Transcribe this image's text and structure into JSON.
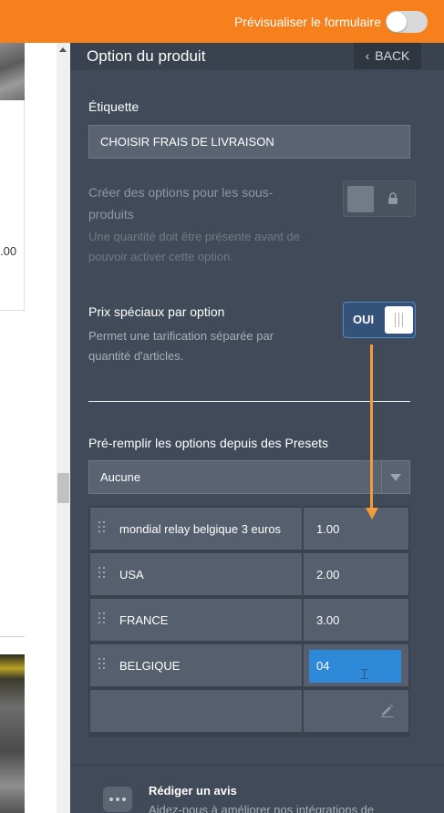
{
  "topbar": {
    "preview_label": "Prévisualiser le formulaire",
    "preview_enabled": false
  },
  "background": {
    "price_fragment": ".00"
  },
  "panel": {
    "title": "Option du produit",
    "back_label": "BACK",
    "label_field": {
      "title": "Étiquette",
      "value": "CHOISIR FRAIS DE LIVRAISON"
    },
    "sub_options": {
      "title": "Créer des options pour les sous-produits",
      "description": "Une quantité doit être présente avant de pouvoir activer cette option.",
      "locked": true
    },
    "special_prices": {
      "title": "Prix spéciaux par option",
      "description": "Permet une tarification séparée par quantité d'articles.",
      "toggle_label": "OUI",
      "enabled": true
    },
    "presets": {
      "title": "Pré-remplir les options depuis des Presets",
      "selected": "Aucune"
    },
    "options": [
      {
        "name": "mondial relay belgique 3 euros",
        "price": "1.00"
      },
      {
        "name": "USA",
        "price": "2.00"
      },
      {
        "name": "FRANCE",
        "price": "3.00"
      },
      {
        "name": "BELGIQUE",
        "price": "04"
      }
    ],
    "review": {
      "title": "Rédiger un avis",
      "description": "Aidez-nous à améliorer nos intégrations de"
    }
  },
  "colors": {
    "accent_orange": "#f5801c",
    "panel_bg": "#414a58",
    "active_input": "#2f89d9",
    "annotation_arrow": "#f39a3b"
  },
  "icons": [
    "chevron-left-icon",
    "lock-icon",
    "drag-handle-icon",
    "pencil-icon",
    "chat-bubble-icon",
    "dropdown-caret-icon"
  ]
}
